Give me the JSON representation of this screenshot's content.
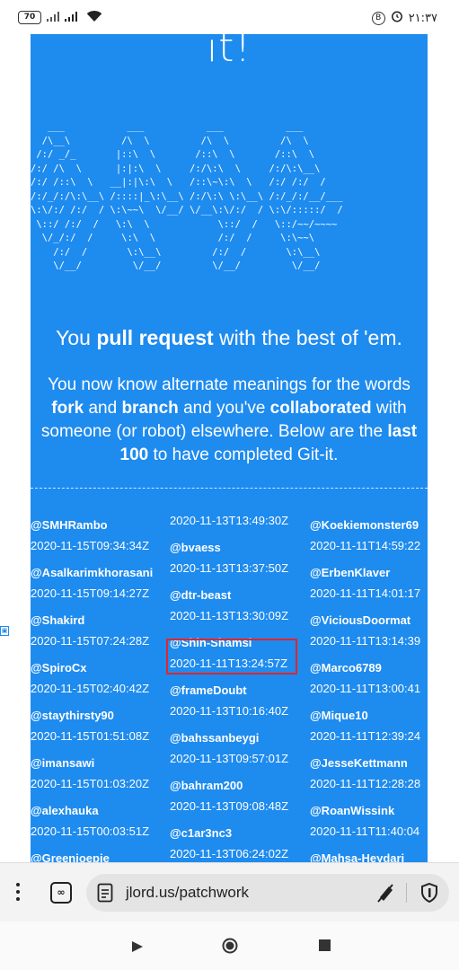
{
  "status_bar": {
    "battery": "70",
    "time": "۲۱:۳۷",
    "b_icon": "B"
  },
  "page": {
    "title_fragment": "it!",
    "ascii_art": "   ___           ___           ___           ___     \n  /\\__\\         /\\  \\         /\\  \\         /\\  \\    \n /:/ _/_       |::\\  \\       /::\\  \\       /::\\  \\   \n/:/ /\\  \\      |:|:\\  \\     /:/\\:\\  \\     /:/\\:\\__\\  \n/:/ /::\\  \\   __|:|\\:\\  \\   /::\\~\\:\\  \\   /:/ /:/  /  \n/:/_/:/\\:\\__\\ /::::|_\\:\\__\\ /:/\\:\\ \\:\\__\\ /:/_/:/__/___\n\\:\\/:/ /:/  / \\:\\~~\\  \\/__/ \\/__\\:\\/:/  / \\:\\/:::::/  /\n \\::/ /:/  /   \\:\\  \\            \\::/  /   \\::/~~/~~~~ \n  \\/_/:/  /     \\:\\  \\           /:/  /     \\:\\~~\\     \n    /:/  /       \\:\\__\\         /:/  /       \\:\\__\\    \n    \\/__/         \\/__/         \\/__/         \\/__/    ",
    "tagline": {
      "pre": "You ",
      "bold": "pull request",
      "post": " with the best of 'em."
    },
    "para": {
      "t1": "You now know alternate meanings for the words ",
      "b1": "fork",
      "t2": " and ",
      "b2": "branch",
      "t3": " and you've ",
      "b3": "collaborated",
      "t4": " with someone (or robot) elsewhere. Below are the ",
      "b4": "last 100",
      "t5": " to have completed Git-it."
    },
    "columns": [
      [
        {
          "user": "@SMHRambo",
          "time": "2020-11-15T09:34:34Z"
        },
        {
          "user": "@Asalkarimkhorasani",
          "time": "2020-11-15T09:14:27Z"
        },
        {
          "user": "@Shakird",
          "time": "2020-11-15T07:24:28Z"
        },
        {
          "user": "@SpiroCx",
          "time": "2020-11-15T02:40:42Z"
        },
        {
          "user": "@staythirsty90",
          "time": "2020-11-15T01:51:08Z"
        },
        {
          "user": "@imansawi",
          "time": "2020-11-15T01:03:20Z"
        },
        {
          "user": "@alexhauka",
          "time": "2020-11-15T00:03:51Z"
        },
        {
          "user": "@Greenioepie",
          "time": ""
        }
      ],
      [
        {
          "user": "",
          "time": "2020-11-13T13:49:30Z"
        },
        {
          "user": "@bvaess",
          "time": "2020-11-13T13:37:50Z"
        },
        {
          "user": "@dtr-beast",
          "time": "2020-11-13T13:30:09Z"
        },
        {
          "user": "@Shin-Shamsi",
          "time": "2020-11-11T13:24:57Z"
        },
        {
          "user": "@frameDoubt",
          "time": "2020-11-13T10:16:40Z"
        },
        {
          "user": "@bahssanbeygi",
          "time": "2020-11-13T09:57:01Z"
        },
        {
          "user": "@bahram200",
          "time": "2020-11-13T09:08:48Z"
        },
        {
          "user": "@c1ar3nc3",
          "time": "2020-11-13T06:24:02Z"
        }
      ],
      [
        {
          "user": "@Koekiemonster69",
          "time": "2020-11-11T14:59:22"
        },
        {
          "user": "@ErbenKlaver",
          "time": "2020-11-11T14:01:17"
        },
        {
          "user": "@ViciousDoormat",
          "time": "2020-11-11T13:14:39"
        },
        {
          "user": "@Marco6789",
          "time": "2020-11-11T13:00:41"
        },
        {
          "user": "@Mique10",
          "time": "2020-11-11T12:39:24"
        },
        {
          "user": "@JesseKettmann",
          "time": "2020-11-11T12:28:28"
        },
        {
          "user": "@RoanWissink",
          "time": "2020-11-11T11:40:04"
        },
        {
          "user": "@Mahsa-Heydari",
          "time": ""
        }
      ]
    ],
    "bg_color": "#1e8bef",
    "highlight_color": "#e0262a"
  },
  "browser": {
    "url": "jlord.us/patchwork",
    "tab_icon": "∞",
    "icons": [
      "menu-dots-icon",
      "tab-switcher-icon",
      "page-icon",
      "mic-off-icon",
      "shield-icon"
    ]
  },
  "nav": {
    "icons": [
      "back-icon",
      "home-icon",
      "recents-icon"
    ]
  }
}
